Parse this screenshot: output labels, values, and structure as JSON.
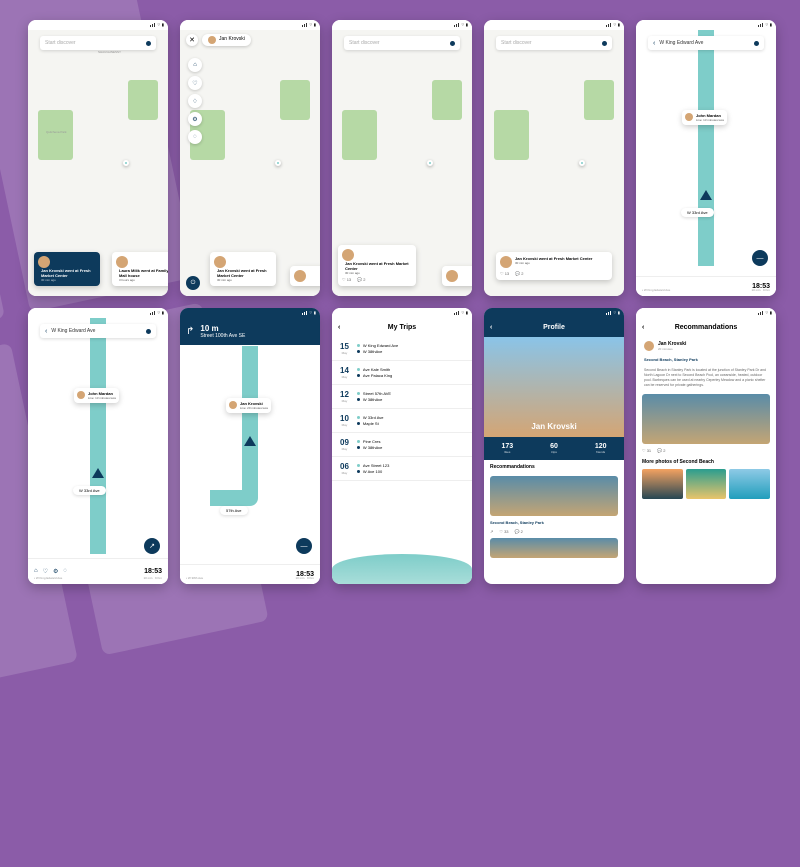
{
  "status": {
    "signal": "•••",
    "wifi": "⌔",
    "battery": "▮"
  },
  "search": {
    "placeholder": "Start discover"
  },
  "streets": {
    "shaughnessy": "SHAUGHNESSY",
    "w33": "W 33rd Ave",
    "w38": "W 38th Ave",
    "king_edward": "W King Edward Ave",
    "ave_57": "57th Ave"
  },
  "parks": {
    "quilchena": "Quilchena Park"
  },
  "users": {
    "jan": {
      "name": "Jan Krovski",
      "action": "went at Fresh Market Center",
      "ago": "30 min ago",
      "live": "20 minutes less"
    },
    "laura": {
      "name": "Laura Milik",
      "action": "went at Family Mall house",
      "ago": "3 hours ago"
    },
    "john": {
      "name": "John Mardan",
      "live": "13 minutes less"
    }
  },
  "engage": {
    "like": "13",
    "comment": "2",
    "likes2": "33",
    "comments2": "2",
    "likes3": "31",
    "comments3": "2"
  },
  "nav": {
    "dist": "10 m",
    "street": "Street 100th Ave SE",
    "time": "18:53",
    "min": "10 min",
    "km": "9 Km"
  },
  "trips": {
    "title": "My Trips",
    "items": [
      {
        "day": "15",
        "month": "May",
        "from": "W King Edward Ave",
        "to": "W 38thAve"
      },
      {
        "day": "14",
        "month": "May",
        "from": "Ave Kale Smith",
        "to": "Ave Palaca King"
      },
      {
        "day": "12",
        "month": "May",
        "from": "Street 57th AVE",
        "to": "W 38thAve"
      },
      {
        "day": "10",
        "month": "May",
        "from": "W 33rd Ave",
        "to": "Maple St"
      },
      {
        "day": "09",
        "month": "May",
        "from": "Pine Cres",
        "to": "W 38thAve"
      },
      {
        "day": "06",
        "month": "May",
        "from": "Ave Street 123",
        "to": "W Ave 100"
      }
    ]
  },
  "profile": {
    "title": "Profile",
    "name": "Jan  Krovski",
    "stats": [
      {
        "n": "173",
        "l": "likes"
      },
      {
        "n": "60",
        "l": "trips"
      },
      {
        "n": "120",
        "l": "friends"
      }
    ],
    "rec_title": "Recommandations",
    "rec_caption": "Second Beach, Stanley Park"
  },
  "rec": {
    "title": "Recommandations",
    "user": "Jan Krovski",
    "user_sub": "20 minutes",
    "place": "Second Beach, Stanley Park",
    "text": "Second Beach in Stanley Park is located at the junction of Stanley Park Dr and North Lagoon Dr next to Second Beach Pool, an oceanside, heated, outdoor pool. Barbeques can be used at nearby Ceperley Meadow and a picnic shelter can be reserved for private gatherings.",
    "more": "More photos of Second Beach"
  }
}
